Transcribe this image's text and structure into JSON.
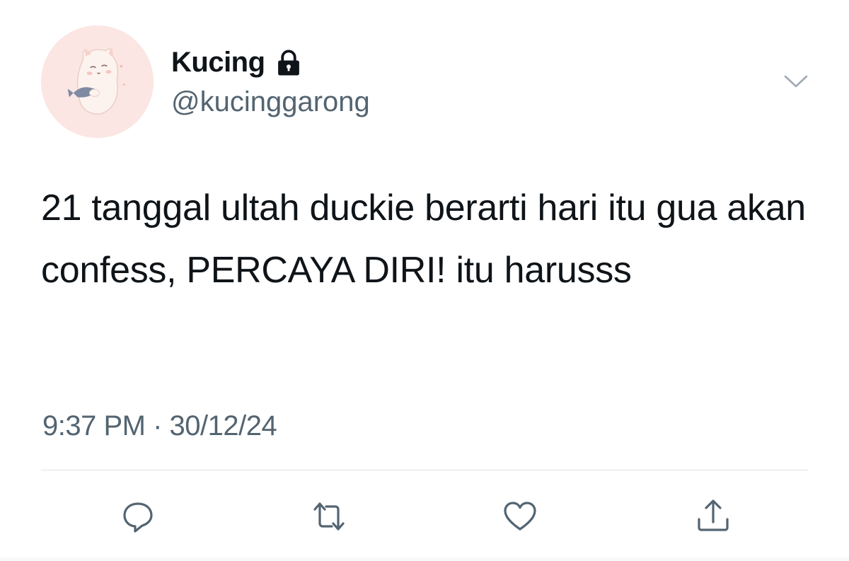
{
  "user": {
    "display_name": "Kucing",
    "handle": "@kucinggarong",
    "protected_icon": "lock-icon",
    "avatar": "cat-holding-fish-avatar"
  },
  "tweet": {
    "text": "21 tanggal ultah duckie berarti hari itu gua akan confess, PERCAYA DIRI! itu harusss",
    "time": "9:37 PM",
    "separator": "·",
    "date": "30/12/24"
  },
  "actions": [
    {
      "name": "reply",
      "icon": "reply-icon"
    },
    {
      "name": "retweet",
      "icon": "retweet-icon"
    },
    {
      "name": "like",
      "icon": "heart-icon"
    },
    {
      "name": "share",
      "icon": "share-icon"
    }
  ],
  "menu_icon": "chevron-down-icon",
  "colors": {
    "text": "#0f1419",
    "secondary": "#536471",
    "divider": "#dfe3e6",
    "avatar_bg": "#fbe6e3"
  }
}
